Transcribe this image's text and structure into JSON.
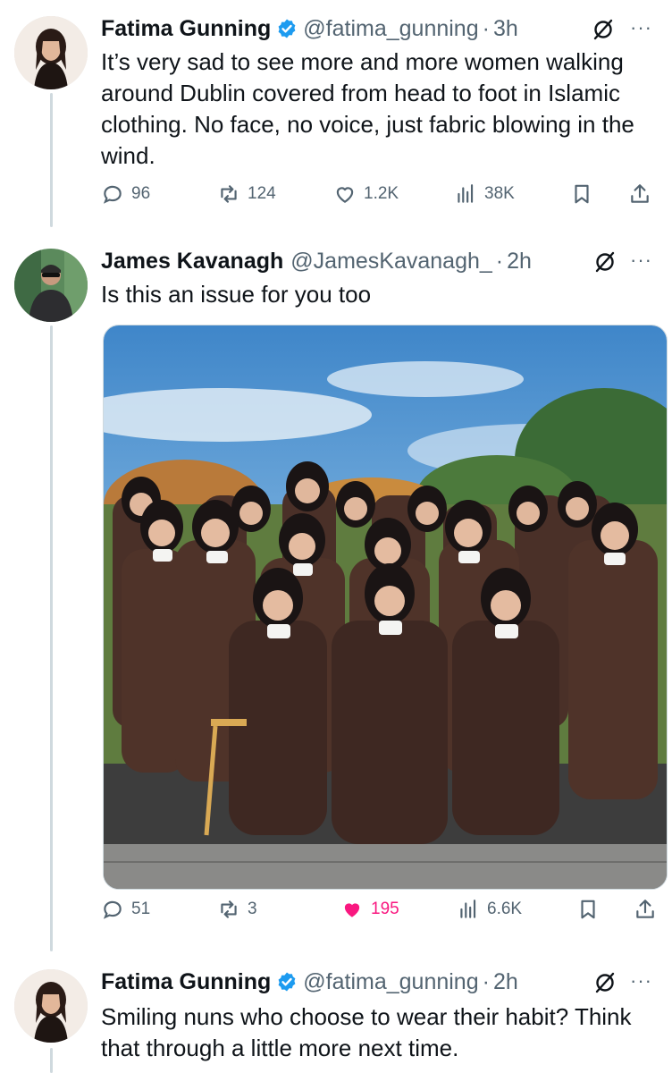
{
  "tweets": [
    {
      "name": "Fatima Gunning",
      "verified": true,
      "handle": "@fatima_gunning",
      "time": "3h",
      "text": "It’s very sad to see more and more women walking around Dublin covered from head to foot in Islamic clothing. No face, no voice, just fabric blowing in the wind.",
      "stats": {
        "replies": "96",
        "reposts": "124",
        "likes": "1.2K",
        "views": "38K"
      }
    },
    {
      "name": "James Kavanagh",
      "verified": false,
      "handle": "@JamesKavanagh_",
      "time": "2h",
      "text": "Is this an issue for you too",
      "stats": {
        "replies": "51",
        "reposts": "3",
        "likes": "195",
        "views": "6.6K"
      },
      "liked": true
    },
    {
      "name": "Fatima Gunning",
      "verified": true,
      "handle": "@fatima_gunning",
      "time": "2h",
      "text": "Smiling nuns who choose to wear their habit? Think that through a little more next time."
    }
  ],
  "separator": "·",
  "more_glyph": "···",
  "colors": {
    "verified": "#1d9bf0",
    "liked": "#f91880",
    "text": "#0f1419",
    "muted": "#536471",
    "habit": "#4a3028",
    "veil": "#1a1414"
  },
  "icons": [
    "verified-badge-icon",
    "grok-icon",
    "more-icon",
    "reply-icon",
    "repost-icon",
    "like-icon",
    "views-icon",
    "bookmark-icon",
    "share-icon"
  ]
}
